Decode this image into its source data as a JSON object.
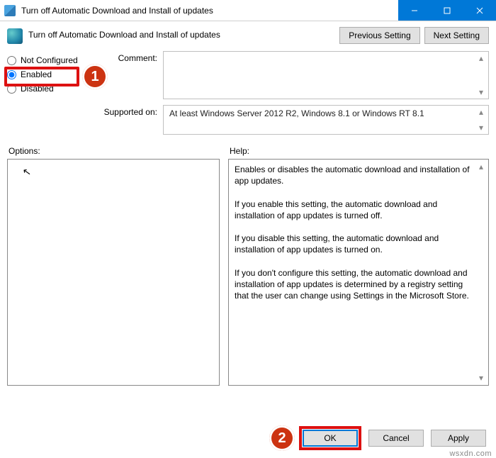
{
  "window": {
    "title": "Turn off Automatic Download and Install of updates"
  },
  "header": {
    "policy_title": "Turn off Automatic Download and Install of updates",
    "prev_btn": "Previous Setting",
    "next_btn": "Next Setting"
  },
  "radios": {
    "not_configured": "Not Configured",
    "enabled": "Enabled",
    "disabled": "Disabled",
    "selected": "enabled"
  },
  "fields": {
    "comment_label": "Comment:",
    "comment_value": "",
    "supported_label": "Supported on:",
    "supported_value": "At least Windows Server 2012 R2, Windows 8.1 or Windows RT 8.1"
  },
  "panes": {
    "options_label": "Options:",
    "help_label": "Help:",
    "help_text": "Enables or disables the automatic download and installation of app updates.\n\nIf you enable this setting, the automatic download and installation of app updates is turned off.\n\nIf you disable this setting, the automatic download and installation of app updates is turned on.\n\nIf you don't configure this setting, the automatic download and installation of app updates is determined by a registry setting that the user can change using Settings in the Microsoft Store."
  },
  "footer": {
    "ok": "OK",
    "cancel": "Cancel",
    "apply": "Apply"
  },
  "markers": {
    "one": "1",
    "two": "2"
  },
  "watermark": "wsxdn.com"
}
